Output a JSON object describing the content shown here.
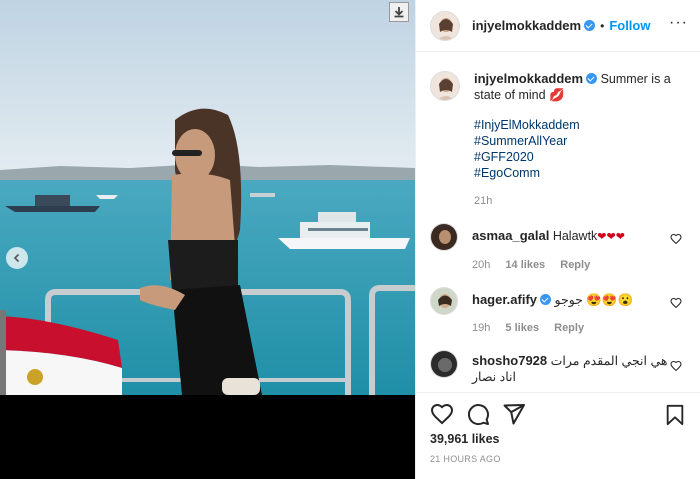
{
  "post": {
    "username": "injyelmokkaddem",
    "follow_label": "Follow",
    "dot": "•",
    "more_label": "···"
  },
  "caption": {
    "username": "injyelmokkaddem",
    "text": "Summer is a state of mind 💋",
    "hashtags": [
      "#InjyElMokkaddem",
      "#SummerAllYear",
      "#GFF2020",
      "#EgoComm"
    ],
    "time": "21h"
  },
  "comments": [
    {
      "username": "asmaa_galal",
      "text": "Halawtk",
      "hearts": "❤❤❤",
      "time": "20h",
      "likes": "14 likes",
      "reply": "Reply",
      "verified": false
    },
    {
      "username": "hager.afify",
      "text": "جوجو 😍😍😮",
      "time": "19h",
      "likes": "5 likes",
      "reply": "Reply",
      "verified": true
    },
    {
      "username": "shosho7928",
      "text": "هي انجي المقدم مرات اناد نصار",
      "verified": false
    }
  ],
  "footer": {
    "likes": "39,961 likes",
    "time_ago": "21 HOURS AGO"
  },
  "colors": {
    "link": "#0095f6",
    "hashtag": "#00376b",
    "secondary_text": "#8e8e8e",
    "verified": "#3897f0"
  },
  "icons": [
    "download-icon",
    "chevron-left-icon",
    "heart-icon",
    "comment-icon",
    "share-icon",
    "bookmark-icon",
    "verified-icon",
    "more-options-icon"
  ]
}
